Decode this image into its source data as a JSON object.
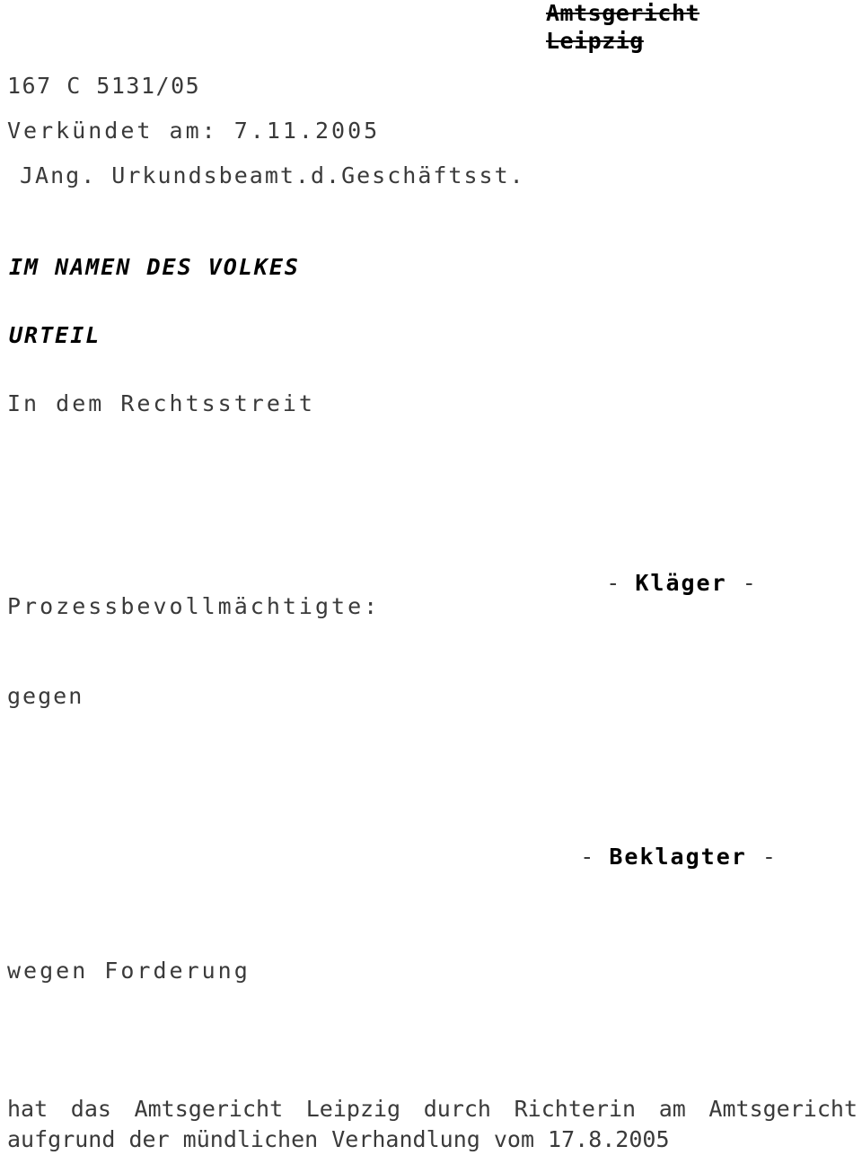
{
  "document": {
    "type": "german-court-judgment",
    "court_header": {
      "line1": "Amtsgericht",
      "line2": "Leipzig",
      "struck_through": true
    },
    "case_number": "167 C 5131/05",
    "announcement": "Verkündet am: 7.11.2005",
    "clerk": "JAng. Urkundsbeamt.d.Geschäftsst.",
    "formal_heading": "IM NAMEN DES VOLKES",
    "judgment_word": "URTEIL",
    "dispute_intro": "In dem Rechtsstreit",
    "plaintiff_marker": {
      "dash_left": "-",
      "label": "Kläger",
      "dash_right": "-"
    },
    "plaintiff_counsel_label": "Prozessbevollmächtigte:",
    "versus": "gegen",
    "defendant_marker": {
      "dash_left": "-",
      "label": "Beklagter",
      "dash_right": "-"
    },
    "subject_matter": "wegen Forderung",
    "closing": {
      "line1": "hat das Amtsgericht Leipzig durch Richterin am Amtsgericht",
      "line2": "aufgrund der mündlichen Verhandlung vom 17.8.2005"
    }
  },
  "colors": {
    "page_background": "#ffffff",
    "body_text": "#3a3a3a",
    "emphasis_text": "#000000"
  }
}
